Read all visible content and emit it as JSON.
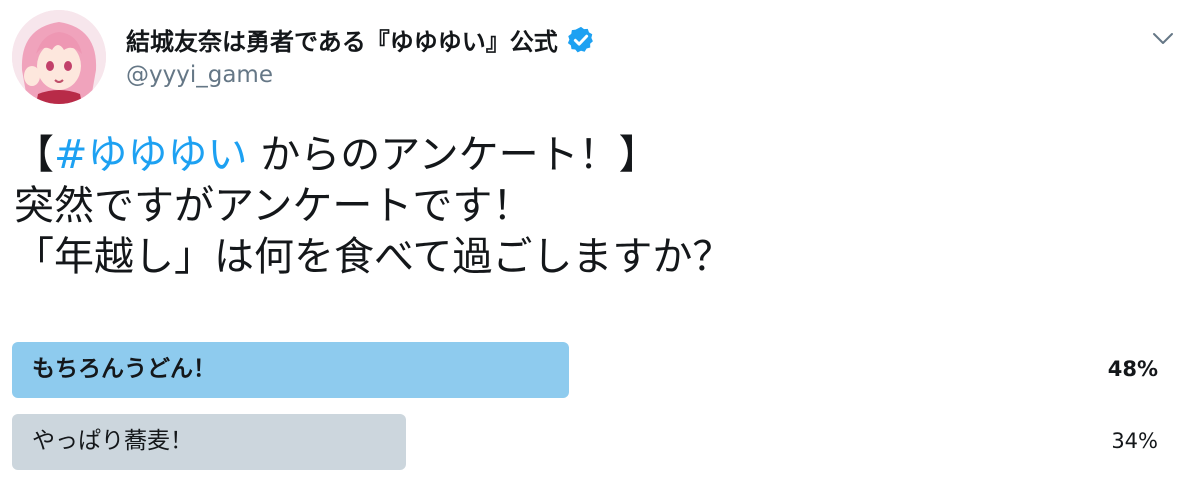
{
  "user": {
    "display_name": "結城友奈は勇者である『ゆゆゆい』公式",
    "handle": "@yyyi_game",
    "verified": true
  },
  "tweet": {
    "hashtag": "#ゆゆゆい",
    "line1_prefix": "【",
    "line1_suffix": " からのアンケート！】",
    "line2": "突然ですがアンケートです！",
    "line3": "「年越し」は何を食べて過ごしますか？"
  },
  "poll": {
    "options": [
      {
        "label": "もちろんうどん！",
        "percent_text": "48%",
        "percent": 48,
        "winner": true
      },
      {
        "label": "やっぱり蕎麦！",
        "percent_text": "34%",
        "percent": 34,
        "winner": false
      }
    ]
  },
  "colors": {
    "winner_bar": "#8ecbee",
    "other_bar": "#ccd6dd",
    "hashtag": "#1da1f2",
    "verified_badge": "#1da1f2",
    "handle": "#657786"
  },
  "icons": {
    "verified": "verified-badge-icon",
    "caret": "chevron-down-icon"
  }
}
